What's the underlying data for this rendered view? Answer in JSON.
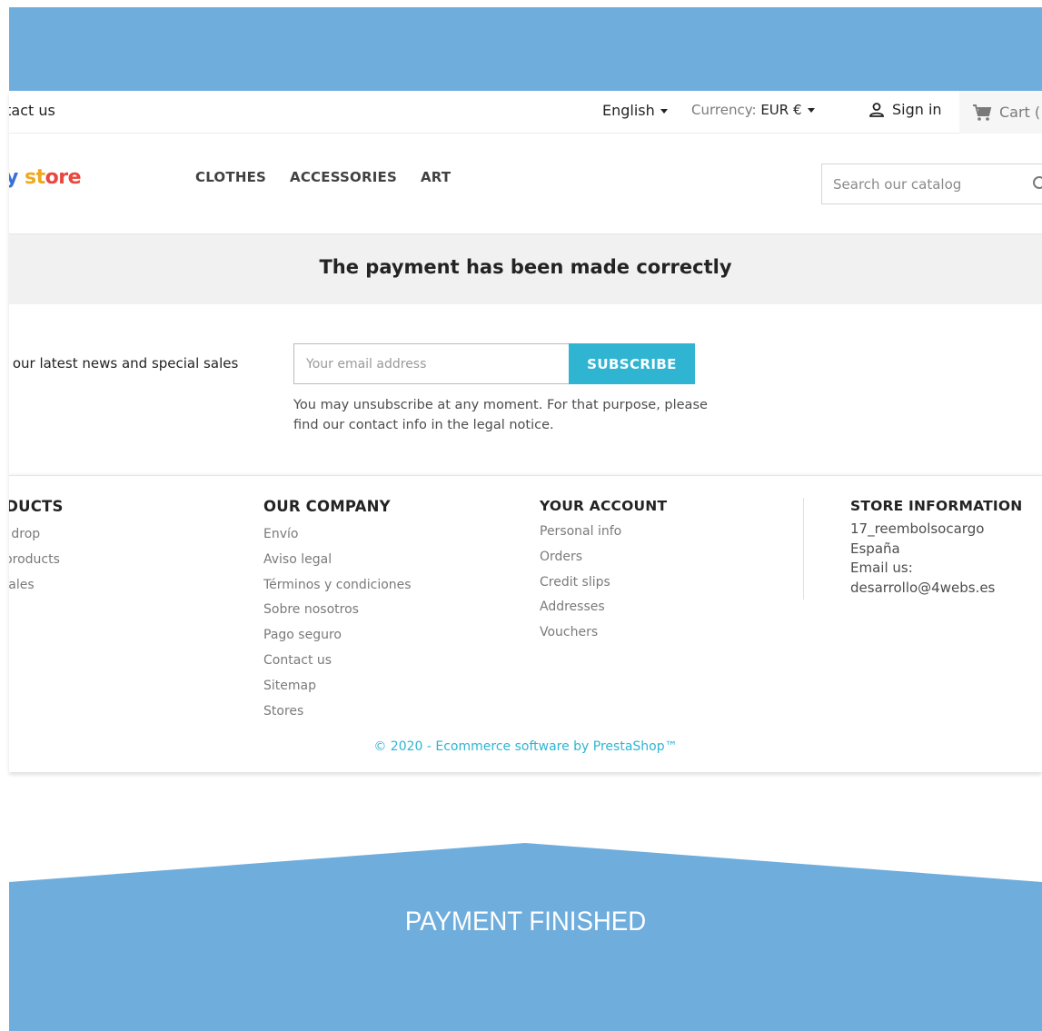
{
  "topnav": {
    "contact_label": "ntact us",
    "language": "English",
    "currency_label": "Currency:",
    "currency_value": "EUR €",
    "signin_label": "Sign in",
    "cart_label": "Cart (",
    "icons": {
      "user": "user-icon",
      "cart": "cart-icon"
    }
  },
  "header": {
    "logo": {
      "part1": "y ",
      "part2": "st",
      "part3": "ore"
    },
    "menu": [
      {
        "label": "CLOTHES"
      },
      {
        "label": "ACCESSORIES"
      },
      {
        "label": "ART"
      }
    ],
    "search_placeholder": "Search our catalog",
    "icons": {
      "search": "search-icon"
    }
  },
  "confirmation": {
    "title": "The payment has been made correctly"
  },
  "newsletter": {
    "text": ": our latest news and special sales",
    "email_placeholder": "Your email address",
    "subscribe_label": "SUBSCRIBE",
    "note": "You may unsubscribe at any moment. For that purpose, please find our contact info in the legal notice."
  },
  "footer": {
    "products": {
      "heading": "ODUCTS",
      "links": [
        "es drop",
        "v products",
        "t sales"
      ]
    },
    "company": {
      "heading": "OUR COMPANY",
      "links": [
        "Envío",
        "Aviso legal",
        "Términos y condiciones",
        "Sobre nosotros",
        "Pago seguro",
        "Contact us",
        "Sitemap",
        "Stores"
      ]
    },
    "account": {
      "heading": "YOUR ACCOUNT",
      "links": [
        "Personal info",
        "Orders",
        "Credit slips",
        "Addresses",
        "Vouchers"
      ]
    },
    "store": {
      "heading": "STORE INFORMATION",
      "lines": [
        "17_reembolsocargo",
        "España",
        "Email us:",
        "desarrollo@4webs.es"
      ]
    },
    "copyright": "© 2020 - Ecommerce software by PrestaShop™"
  },
  "banner": {
    "title": "PAYMENT FINISHED"
  },
  "colors": {
    "band": "#6faddd",
    "accent": "#2fb5d2",
    "text": "#232323",
    "muted": "#7a7a7a"
  }
}
